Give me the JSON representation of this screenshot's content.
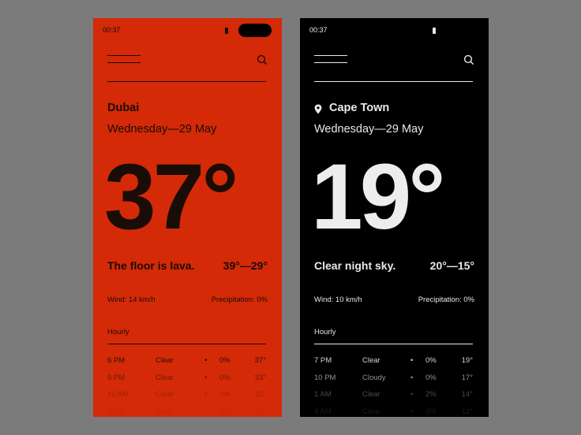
{
  "screens": [
    {
      "status_time": "00:37",
      "city": "Dubai",
      "date": "Wednesday—29 May",
      "temperature": "37°",
      "description": "The floor is lava.",
      "range": "39°—29°",
      "wind": "Wind: 14 km/h",
      "precipitation": "Precipitation: 0%",
      "hourly_title": "Hourly",
      "hourly": [
        {
          "time": "6  PM",
          "condition": "Clear",
          "dot": "•",
          "pct": "0%",
          "temp": "37°"
        },
        {
          "time": "9  PM",
          "condition": "Clear",
          "dot": "•",
          "pct": "0%",
          "temp": "33°"
        },
        {
          "time": "12  AM",
          "condition": "Clear",
          "dot": "•",
          "pct": "0%",
          "temp": "32°"
        },
        {
          "time": "3  AM",
          "condition": "Clear",
          "dot": "•",
          "pct": "0%",
          "temp": "30°"
        }
      ]
    },
    {
      "status_time": "00:37",
      "city": "Cape Town",
      "date": "Wednesday—29 May",
      "temperature": "19°",
      "description": "Clear night sky.",
      "range": "20°—15°",
      "wind": "Wind: 10 km/h",
      "precipitation": "Precipitation: 0%",
      "hourly_title": "Hourly",
      "hourly": [
        {
          "time": "7  PM",
          "condition": "Clear",
          "dot": "•",
          "pct": "0%",
          "temp": "19°"
        },
        {
          "time": "10  PM",
          "condition": "Cloudy",
          "dot": "•",
          "pct": "0%",
          "temp": "17°"
        },
        {
          "time": "1  AM",
          "condition": "Clear",
          "dot": "•",
          "pct": "2%",
          "temp": "14°"
        },
        {
          "time": "4  AM",
          "condition": "Clear",
          "dot": "•",
          "pct": "3%",
          "temp": "13°"
        }
      ]
    }
  ],
  "colors": {
    "background": "#7b7b7b",
    "red_screen": "#d42a08",
    "black_screen": "#000000",
    "red_text": "#1a0c06",
    "black_text": "#e8e8e8"
  },
  "icons": [
    "menu-icon",
    "search-icon",
    "location-pin-icon",
    "battery-icon"
  ]
}
